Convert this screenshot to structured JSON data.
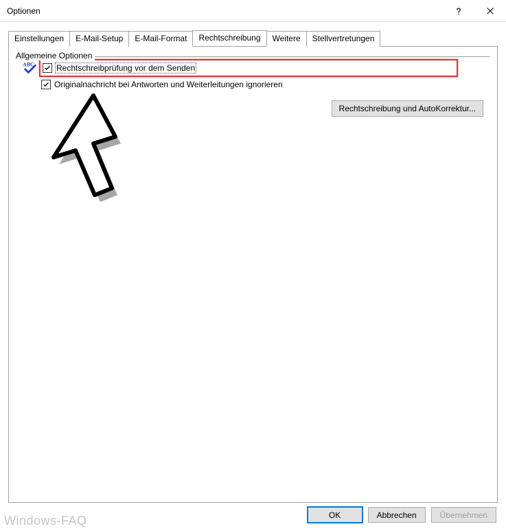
{
  "window": {
    "title": "Optionen"
  },
  "tabs": [
    {
      "label": "Einstellungen"
    },
    {
      "label": "E-Mail-Setup"
    },
    {
      "label": "E-Mail-Format"
    },
    {
      "label": "Rechtschreibung",
      "active": true
    },
    {
      "label": "Weitere"
    },
    {
      "label": "Stellvertretungen"
    }
  ],
  "group": {
    "title": "Allgemeine Optionen",
    "option1": {
      "label": "Rechtschreibprüfung vor dem Senden",
      "checked": true
    },
    "option2": {
      "label": "Originalnachricht bei Antworten und Weiterleitungen ignorieren",
      "checked": true
    },
    "autocorrect_button": "Rechtschreibung und AutoKorrektur..."
  },
  "buttons": {
    "ok": "OK",
    "cancel": "Abbrechen",
    "apply": "Übernehmen"
  },
  "watermark": "Windows-FAQ"
}
